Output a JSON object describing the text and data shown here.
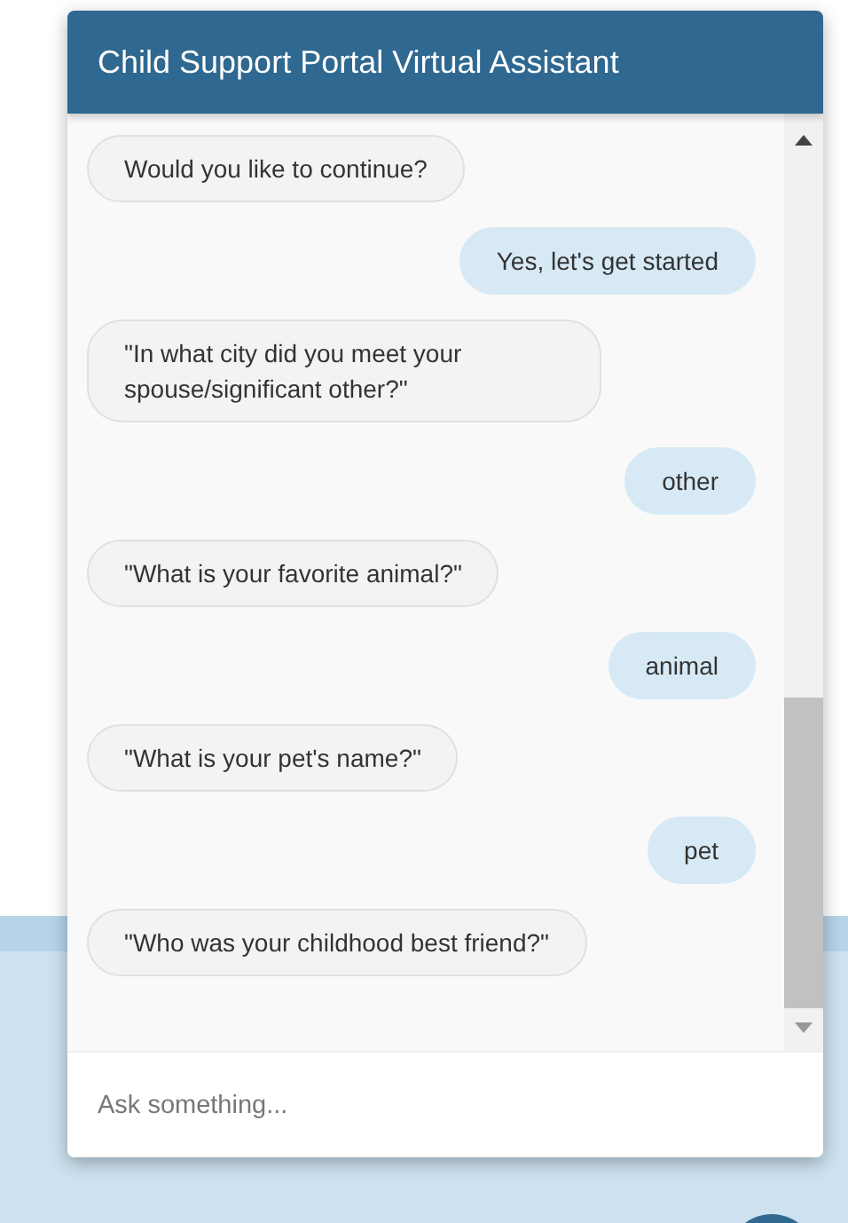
{
  "window": {
    "title": "Child Support Portal Virtual Assistant"
  },
  "messages": [
    {
      "kind": "bot",
      "text": "Would you like to continue?"
    },
    {
      "kind": "user",
      "text": "Yes, let's get started"
    },
    {
      "kind": "bot",
      "text": "\"In what city did you meet your spouse/significant other?\""
    },
    {
      "kind": "user",
      "text": "other"
    },
    {
      "kind": "bot",
      "text": "\"What is your favorite animal?\""
    },
    {
      "kind": "user",
      "text": "animal"
    },
    {
      "kind": "bot",
      "text": "\"What is your pet's name?\""
    },
    {
      "kind": "user",
      "text": "pet"
    },
    {
      "kind": "bot",
      "text": "\"Who was your childhood best friend?\""
    }
  ],
  "input": {
    "placeholder": "Ask something..."
  }
}
